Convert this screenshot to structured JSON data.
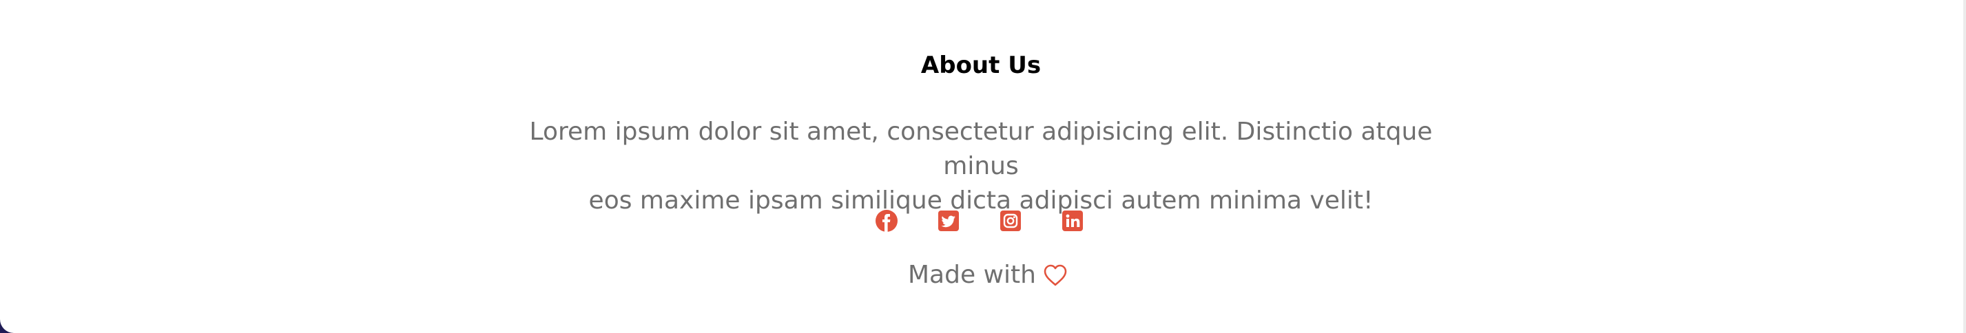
{
  "footer": {
    "title": "About Us",
    "description_line1": "Lorem ipsum dolor sit amet, consectetur adipisicing elit. Distinctio atque minus",
    "description_line2": "eos maxime ipsam similique dicta adipisci autem minima velit!",
    "social_icons": [
      "facebook-icon",
      "twitter-icon",
      "instagram-icon",
      "linkedin-icon"
    ],
    "made_with_text": "Made with",
    "made_with_icon": "heart-icon"
  },
  "colors": {
    "accent": "#e2533d",
    "text_muted": "#6f6f6f",
    "title": "#000000",
    "background": "#ffffff",
    "backdrop": "#1f1b55"
  }
}
